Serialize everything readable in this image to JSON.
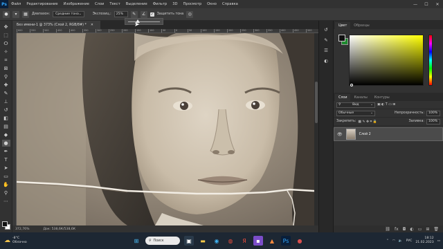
{
  "menu": {
    "logo": "Ps",
    "items": [
      "Файл",
      "Редактирование",
      "Изображение",
      "Слои",
      "Текст",
      "Выделение",
      "Фильтр",
      "3D",
      "Просмотр",
      "Окно",
      "Справка"
    ],
    "window_controls": {
      "minimize": "—",
      "maximize": "☐",
      "close": "✕"
    }
  },
  "options_bar": {
    "range_label": "Диапазон:",
    "range_value": "Средние тона",
    "exposure_label": "Экспозиц.:",
    "exposure_value": "25%",
    "protect_tones_label": "Защитить тона",
    "protect_tones_checked": true,
    "exposure_slider_fraction": 0.3
  },
  "document": {
    "tab_title": "Без имени-1 @ 373% (Слой 2, RGB/8#) *",
    "close_glyph": "✕",
    "ruler_ticks": [
      "600",
      "550",
      "500",
      "450",
      "400",
      "350",
      "300",
      "250",
      "200",
      "150",
      "100",
      "50",
      "0",
      "50",
      "100",
      "150",
      "200",
      "250",
      "300",
      "350",
      "400",
      "450",
      "500"
    ]
  },
  "status_bar": {
    "zoom": "372,76%",
    "doc_info": "Док: 538,6К/538,6К"
  },
  "color_panel": {
    "tabs": [
      "Цвет",
      "Образцы"
    ],
    "foreground": "#111111",
    "background": "#1e8a2e"
  },
  "layers_panel": {
    "tabs": [
      "Слои",
      "Каналы",
      "Контуры"
    ],
    "filter_label": "Вид",
    "blend_mode": "Обычные",
    "opacity_label": "Непрозрачность:",
    "opacity_value": "100%",
    "lock_label": "Закрепить:",
    "fill_label": "Заливка:",
    "fill_value": "100%",
    "layer_name": "Слой 2"
  },
  "taskbar": {
    "weather_temp": "-8°C",
    "weather_desc": "Облачно",
    "search_label": "Поиск",
    "language": "РУС",
    "time": "18:12",
    "date": "21.02.2023"
  },
  "colors": {
    "ui_dark": "#323232",
    "accent_ps": "#31a8ff",
    "taskbar": "#1d2733"
  }
}
